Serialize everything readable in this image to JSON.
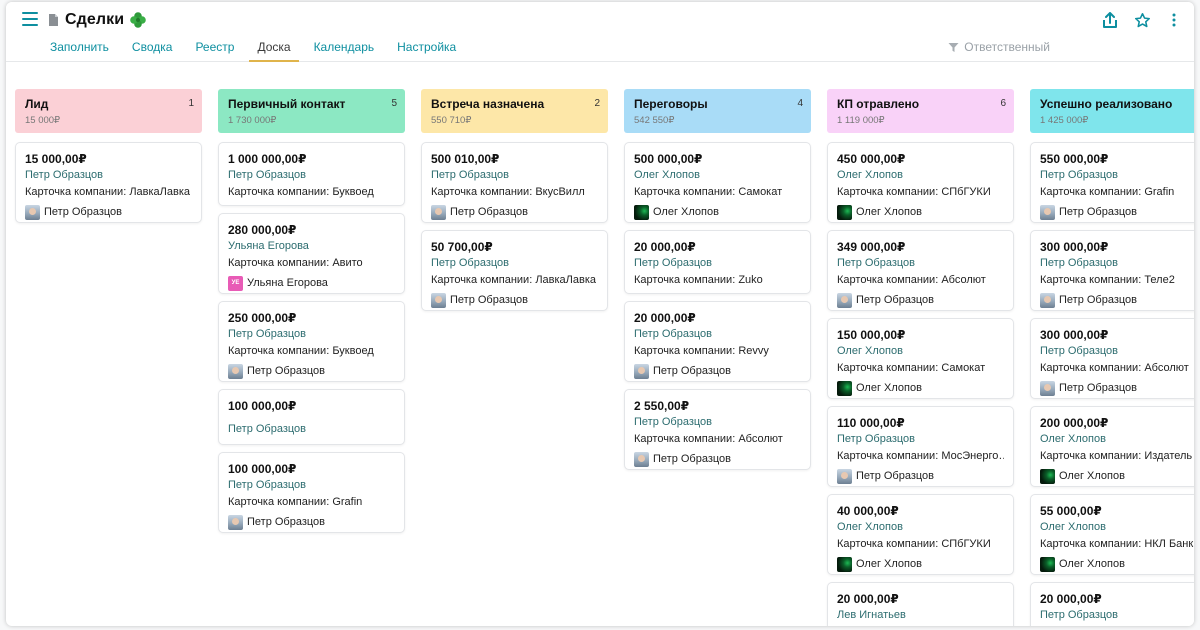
{
  "app": {
    "title": "Сделки"
  },
  "tabs": [
    {
      "label": "Заполнить",
      "active": false
    },
    {
      "label": "Сводка",
      "active": false
    },
    {
      "label": "Реестр",
      "active": false
    },
    {
      "label": "Доска",
      "active": true
    },
    {
      "label": "Календарь",
      "active": false
    },
    {
      "label": "Настройка",
      "active": false
    }
  ],
  "filter": {
    "label": "Ответственный"
  },
  "icons": {
    "menu": "hamburger-icon",
    "doc": "document-icon",
    "clover": "clover-icon",
    "share": "share-icon",
    "star": "star-icon",
    "more": "more-vertical-icon",
    "filter": "filter-icon"
  },
  "colors": {
    "accent": "#0e8fa0",
    "active_tab_underline": "#e0b44b"
  },
  "columns": [
    {
      "title": "Лид",
      "count": "1",
      "sum": "15 000₽",
      "color": "#fbd0d6",
      "cards": [
        {
          "amount": "15 000,00₽",
          "person": "Петр Образцов",
          "company": "Карточка компании: ЛавкаЛавка",
          "responsible": "Петр Образцов",
          "avatar": "photo"
        }
      ]
    },
    {
      "title": "Первичный контакт",
      "count": "5",
      "sum": "1 730 000₽",
      "color": "#8ce8c3",
      "cards": [
        {
          "amount": "1 000 000,00₽",
          "person": "Петр Образцов",
          "company": "Карточка компании: Буквоед",
          "responsible": "",
          "avatar": ""
        },
        {
          "amount": "280 000,00₽",
          "person": "Ульяна Егорова",
          "company": "Карточка компании: Авито",
          "responsible": "Ульяна Егорова",
          "avatar": "initials",
          "initials": "УЕ"
        },
        {
          "amount": "250 000,00₽",
          "person": "Петр Образцов",
          "company": "Карточка компании: Буквоед",
          "responsible": "Петр Образцов",
          "avatar": "photo"
        },
        {
          "amount": "100 000,00₽",
          "person": "Петр Образцов",
          "company": "",
          "responsible": "",
          "avatar": ""
        },
        {
          "amount": "100 000,00₽",
          "person": "Петр Образцов",
          "company": "Карточка компании: Grafin",
          "responsible": "Петр Образцов",
          "avatar": "photo"
        }
      ]
    },
    {
      "title": "Встреча назначена",
      "count": "2",
      "sum": "550 710₽",
      "color": "#fde7a8",
      "cards": [
        {
          "amount": "500 010,00₽",
          "person": "Петр Образцов",
          "company": "Карточка компании: ВкусВилл",
          "responsible": "Петр Образцов",
          "avatar": "photo"
        },
        {
          "amount": "50 700,00₽",
          "person": "Петр Образцов",
          "company": "Карточка компании: ЛавкаЛавка",
          "responsible": "Петр Образцов",
          "avatar": "photo"
        }
      ]
    },
    {
      "title": "Переговоры",
      "count": "4",
      "sum": "542 550₽",
      "color": "#a9dcf7",
      "cards": [
        {
          "amount": "500 000,00₽",
          "person": "Олег Хлопов",
          "company": "Карточка компании: Самокат",
          "responsible": "Олег Хлопов",
          "avatar": "dark"
        },
        {
          "amount": "20 000,00₽",
          "person": "Петр Образцов",
          "company": "Карточка компании: Zuko",
          "responsible": "",
          "avatar": ""
        },
        {
          "amount": "20 000,00₽",
          "person": "Петр Образцов",
          "company": "Карточка компании: Revvy",
          "responsible": "Петр Образцов",
          "avatar": "photo"
        },
        {
          "amount": "2 550,00₽",
          "person": "Петр Образцов",
          "company": "Карточка компании: Абсолют",
          "responsible": "Петр Образцов",
          "avatar": "photo"
        }
      ]
    },
    {
      "title": "КП отравлено",
      "count": "6",
      "sum": "1 119 000₽",
      "color": "#f9d2f8",
      "cards": [
        {
          "amount": "450 000,00₽",
          "person": "Олег Хлопов",
          "company": "Карточка компании: СПбГУКИ",
          "responsible": "Олег Хлопов",
          "avatar": "dark"
        },
        {
          "amount": "349 000,00₽",
          "person": "Петр Образцов",
          "company": "Карточка компании: Абсолют",
          "responsible": "Петр Образцов",
          "avatar": "photo"
        },
        {
          "amount": "150 000,00₽",
          "person": "Олег Хлопов",
          "company": "Карточка компании: Самокат",
          "responsible": "Олег Хлопов",
          "avatar": "dark"
        },
        {
          "amount": "110 000,00₽",
          "person": "Петр Образцов",
          "company": "Карточка компании: МосЭнерго…",
          "responsible": "Петр Образцов",
          "avatar": "photo"
        },
        {
          "amount": "40 000,00₽",
          "person": "Олег Хлопов",
          "company": "Карточка компании: СПбГУКИ",
          "responsible": "Олег Хлопов",
          "avatar": "dark"
        },
        {
          "amount": "20 000,00₽",
          "person": "Лев Игнатьев",
          "company": "",
          "responsible": "",
          "avatar": ""
        }
      ]
    },
    {
      "title": "Успешно реализовано",
      "count": "",
      "sum": "1 425 000₽",
      "color": "#7fe5ec",
      "cards": [
        {
          "amount": "550 000,00₽",
          "person": "Петр Образцов",
          "company": "Карточка компании: Grafin",
          "responsible": "Петр Образцов",
          "avatar": "photo"
        },
        {
          "amount": "300 000,00₽",
          "person": "Петр Образцов",
          "company": "Карточка компании: Теле2",
          "responsible": "Петр Образцов",
          "avatar": "photo"
        },
        {
          "amount": "300 000,00₽",
          "person": "Петр Образцов",
          "company": "Карточка компании: Абсолют",
          "responsible": "Петр Образцов",
          "avatar": "photo"
        },
        {
          "amount": "200 000,00₽",
          "person": "Олег Хлопов",
          "company": "Карточка компании: Издатель",
          "responsible": "Олег Хлопов",
          "avatar": "dark"
        },
        {
          "amount": "55 000,00₽",
          "person": "Олег Хлопов",
          "company": "Карточка компании: НКЛ Банк",
          "responsible": "Олег Хлопов",
          "avatar": "dark"
        },
        {
          "amount": "20 000,00₽",
          "person": "Петр Образцов",
          "company": "",
          "responsible": "",
          "avatar": ""
        }
      ]
    }
  ]
}
